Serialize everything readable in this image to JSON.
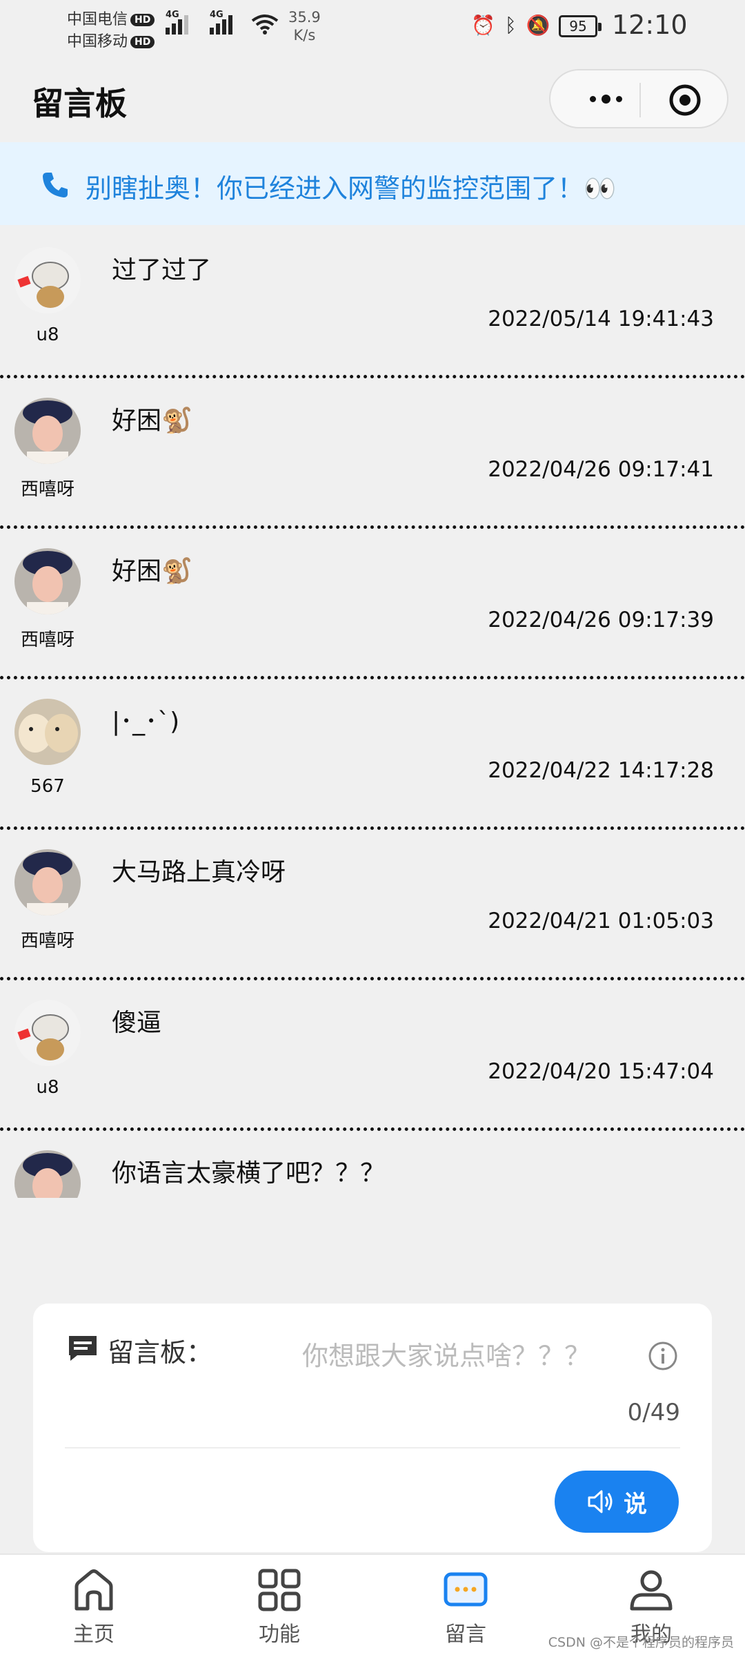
{
  "status_bar": {
    "carrier1": "中国电信",
    "carrier2": "中国移动",
    "hd": "HD",
    "net1": "4G",
    "net2": "4G",
    "speed_value": "35.9",
    "speed_unit": "K/s",
    "battery": "95",
    "time": "12:10"
  },
  "header": {
    "title": "留言板"
  },
  "notice": {
    "text": "别瞎扯奥！你已经进入网警的监控范围了！👀"
  },
  "messages": [
    {
      "user": "u8",
      "avatar": "cubone",
      "text": "过了过了",
      "time": "2022/05/14 19:41:43"
    },
    {
      "user": "西嘻呀",
      "avatar": "girl",
      "text": "好困🐒",
      "time": "2022/04/26 09:17:41"
    },
    {
      "user": "西嘻呀",
      "avatar": "girl",
      "text": "好困🐒",
      "time": "2022/04/26 09:17:39"
    },
    {
      "user": "567",
      "avatar": "dog",
      "text": "|･_･`)",
      "time": "2022/04/22 14:17:28"
    },
    {
      "user": "西嘻呀",
      "avatar": "girl",
      "text": "大马路上真冷呀",
      "time": "2022/04/21 01:05:03"
    },
    {
      "user": "u8",
      "avatar": "cubone",
      "text": "傻逼",
      "time": "2022/04/20 15:47:04"
    },
    {
      "user": "",
      "avatar": "girl",
      "text": "你语言太豪横了吧？？？",
      "time": ""
    }
  ],
  "composer": {
    "label": "留言板：",
    "placeholder": "你想跟大家说点啥？？？",
    "counter": "0/49",
    "button": "说"
  },
  "tabs": [
    {
      "label": "主页",
      "icon": "home-icon"
    },
    {
      "label": "功能",
      "icon": "grid-icon"
    },
    {
      "label": "留言",
      "icon": "message-icon"
    },
    {
      "label": "我的",
      "icon": "user-icon"
    }
  ],
  "watermark": "CSDN @不是个程序员的程序员",
  "colors": {
    "accent": "#1a82f0",
    "notice_bg": "#e6f4ff",
    "notice_text": "#1f83dc",
    "active_tab": "#f5a623"
  }
}
